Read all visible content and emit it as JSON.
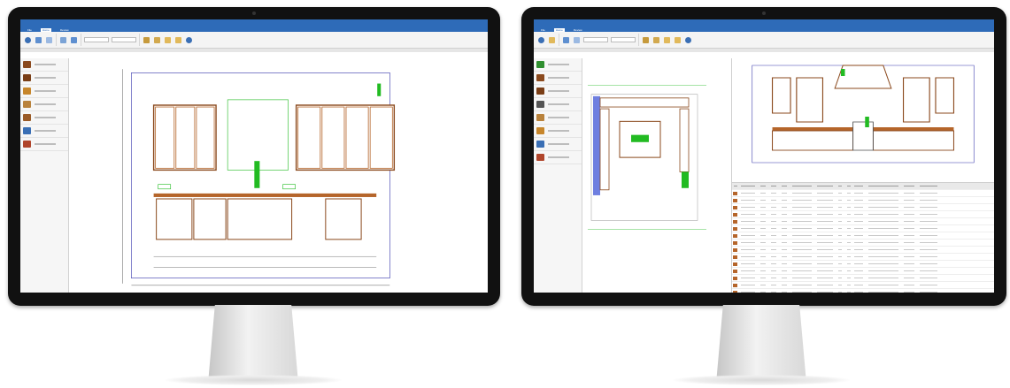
{
  "left_monitor": {
    "menu": [
      "File",
      "Home",
      "Review"
    ],
    "sidebar_items": [
      {
        "icon": "base-cabinet-icon",
        "color": "#8b4a1e"
      },
      {
        "icon": "wall-cabinet-icon",
        "color": "#7a3e16"
      },
      {
        "icon": "molding-icon",
        "color": "#c7862b"
      },
      {
        "icon": "panel-icon",
        "color": "#b9823c"
      },
      {
        "icon": "filler-icon",
        "color": "#9a5a26"
      },
      {
        "icon": "accessory-icon",
        "color": "#3a6fb5"
      },
      {
        "icon": "appliance-icon",
        "color": "#b0452b"
      }
    ]
  },
  "right_monitor": {
    "menu": [
      "File",
      "Home",
      "Review"
    ],
    "sidebar_items": [
      {
        "icon": "catalog-icon",
        "color": "#2f8f2f"
      },
      {
        "icon": "base-cabinet-icon",
        "color": "#8b4a1e"
      },
      {
        "icon": "wall-cabinet-icon",
        "color": "#7a3e16"
      },
      {
        "icon": "lattice-icon",
        "color": "#555555"
      },
      {
        "icon": "panel-icon",
        "color": "#b9823c"
      },
      {
        "icon": "molding-icon",
        "color": "#c7862b"
      },
      {
        "icon": "accessory-icon",
        "color": "#3a6fb5"
      },
      {
        "icon": "appliance-icon",
        "color": "#b0452b"
      }
    ],
    "grid_row_count": 17
  },
  "colors": {
    "titlebar": "#2e6bb8",
    "cabinet": "#b5652a",
    "dimension": "#3333aa",
    "selection": "#22bb22"
  }
}
